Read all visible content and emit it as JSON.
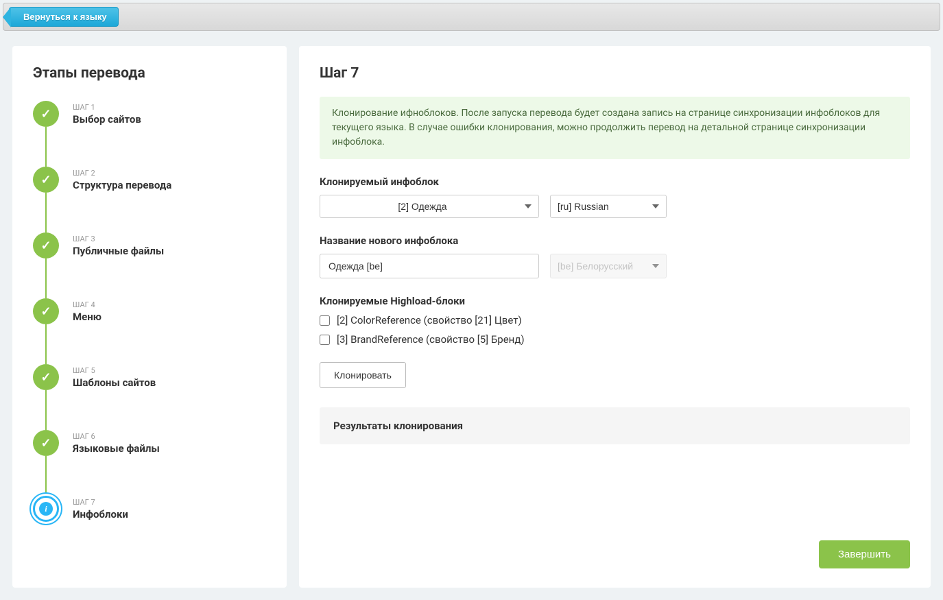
{
  "topbar": {
    "back_label": "Вернуться к языку"
  },
  "sidebar": {
    "title": "Этапы перевода",
    "steps": [
      {
        "label": "ШАГ 1",
        "title": "Выбор сайтов",
        "state": "done"
      },
      {
        "label": "ШАГ 2",
        "title": "Структура перевода",
        "state": "done"
      },
      {
        "label": "ШАГ 3",
        "title": "Публичные файлы",
        "state": "done"
      },
      {
        "label": "ШАГ 4",
        "title": "Меню",
        "state": "done"
      },
      {
        "label": "ШАГ 5",
        "title": "Шаблоны сайтов",
        "state": "done"
      },
      {
        "label": "ШАГ 6",
        "title": "Языковые файлы",
        "state": "done"
      },
      {
        "label": "ШАГ 7",
        "title": "Инфоблоки",
        "state": "current"
      }
    ]
  },
  "main": {
    "title": "Шаг 7",
    "info_text": "Клонирование ифноблоков. После запуска перевода будет создана запись на странице синхронизации инфоблоков для текущего языка. В случае ошибки клонирования, можно продолжить перевод на детальной странице синхронизации инфоблока.",
    "source_block": {
      "label": "Клонируемый инфоблок",
      "iblock_value": "[2] Одежда",
      "lang_value": "[ru] Russian"
    },
    "new_block": {
      "label": "Название нового инфоблока",
      "name_value": "Одежда [be]",
      "lang_value": "[be] Белорусский"
    },
    "highload": {
      "label": "Клонируемые Highload-блоки",
      "items": [
        "[2] ColorReference (свойство [21] Цвет)",
        "[3] BrandReference (свойство [5] Бренд)"
      ]
    },
    "clone_button": "Клонировать",
    "results_title": "Результаты клонирования",
    "finish_button": "Завершить"
  }
}
